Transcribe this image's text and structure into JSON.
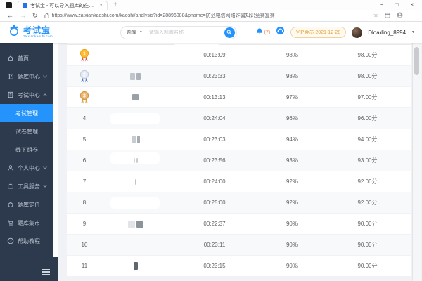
{
  "browser": {
    "tab_title": "考试宝 - 可以导入题库的在线考",
    "tab_close": "×",
    "new_tab": "+",
    "window_controls": {
      "minimize": "−",
      "maximize": "□",
      "close": "×"
    },
    "nav": {
      "back": "←",
      "forward": "→",
      "refresh": "↻"
    },
    "url": "https://www.zaixiankaoshi.com/kaoshi/analysis?id=28896088&pname=防范电信网络诈骗知识竞赛复赛",
    "toolbar": {
      "favorite": "☆",
      "more": "⋯"
    }
  },
  "header": {
    "logo_text": "考试宝",
    "logo_domain": "zaixiankaoshi.com",
    "search": {
      "category": "题库",
      "caret": "▼",
      "placeholder": "请输入题库名称"
    },
    "notification_count": "(7)",
    "vip_badge": "VIP会员 2021-12-28",
    "username": "Dloading_8994",
    "user_caret": "▼"
  },
  "sidebar": {
    "items": [
      {
        "label": "首页"
      },
      {
        "label": "题库中心"
      },
      {
        "label": "考试中心"
      },
      {
        "label": "考试管理"
      },
      {
        "label": "试卷管理"
      },
      {
        "label": "线下组卷"
      },
      {
        "label": "个人中心"
      },
      {
        "label": "工具服务"
      },
      {
        "label": "题库定价"
      },
      {
        "label": "题库集市"
      },
      {
        "label": "帮助教程"
      }
    ]
  },
  "table": {
    "rows": [
      {
        "rank": "1",
        "medal": "gold",
        "time": "00:13:09",
        "percent": "98%",
        "score": "98.00分",
        "name_blocks": []
      },
      {
        "rank": "2",
        "medal": "silver",
        "time": "00:23:33",
        "percent": "98%",
        "score": "98.00分",
        "name_blocks": [
          {
            "w": 7,
            "h": 10,
            "c": "#c2c6cc"
          },
          {
            "w": 6,
            "h": 10,
            "c": "#aeb3ba"
          }
        ]
      },
      {
        "rank": "3",
        "medal": "bronze",
        "time": "00:13:13",
        "percent": "97%",
        "score": "97.00分",
        "name_blocks": [
          {
            "w": 9,
            "h": 9,
            "c": "#9aa0a8"
          }
        ]
      },
      {
        "rank": "4",
        "medal": null,
        "time": "00:24:04",
        "percent": "96%",
        "score": "96.00分",
        "name_blocks": [],
        "patch": true
      },
      {
        "rank": "5",
        "medal": null,
        "time": "00:23:03",
        "percent": "94%",
        "score": "94.00分",
        "name_blocks": [
          {
            "w": 6,
            "h": 11,
            "c": "#c8ccd2"
          },
          {
            "w": 4,
            "h": 11,
            "c": "#a8adb5"
          }
        ]
      },
      {
        "rank": "6",
        "medal": null,
        "time": "00:23:56",
        "percent": "93%",
        "score": "93.00分",
        "name_blocks": [
          {
            "w": 2,
            "h": 7,
            "c": "#d4d7db"
          },
          {
            "w": 2,
            "h": 7,
            "c": "#c9ccd1"
          }
        ],
        "patch": true
      },
      {
        "rank": "7",
        "medal": null,
        "time": "00:24:00",
        "percent": "92%",
        "score": "92.00分",
        "name_blocks": [
          {
            "w": 2,
            "h": 8,
            "c": "#c0c4ca"
          }
        ]
      },
      {
        "rank": "8",
        "medal": null,
        "time": "00:25:00",
        "percent": "92%",
        "score": "92.00分",
        "name_blocks": [],
        "patch": true
      },
      {
        "rank": "9",
        "medal": null,
        "time": "00:22:37",
        "percent": "90%",
        "score": "90.00分",
        "name_blocks": [
          {
            "w": 10,
            "h": 10,
            "c": "#e2e4e8"
          },
          {
            "w": 10,
            "h": 10,
            "c": "#8d939b"
          }
        ]
      },
      {
        "rank": "10",
        "medal": null,
        "time": "00:23:11",
        "percent": "90%",
        "score": "90.00分",
        "name_blocks": []
      },
      {
        "rank": "11",
        "medal": null,
        "time": "00:23:15",
        "percent": "90%",
        "score": "90.00分",
        "name_blocks": [
          {
            "w": 6,
            "h": 11,
            "c": "#5f666e"
          }
        ],
        "patch": true
      }
    ]
  },
  "colors": {
    "accent": "#2593fc",
    "sidebar_bg": "#2d3a4d",
    "vip_text": "#e6a23c",
    "notification": "#ff7a45",
    "medals": {
      "gold": {
        "circle": "#fcbe2d",
        "ring": "#ef9f1f",
        "ribbon": "#e5534b"
      },
      "silver": {
        "circle": "#e7ebf2",
        "ring": "#c3cad6",
        "ribbon": "#4a7dd8"
      },
      "bronze": {
        "circle": "#edb86f",
        "ring": "#d19141",
        "ribbon": "#dca342"
      }
    }
  }
}
